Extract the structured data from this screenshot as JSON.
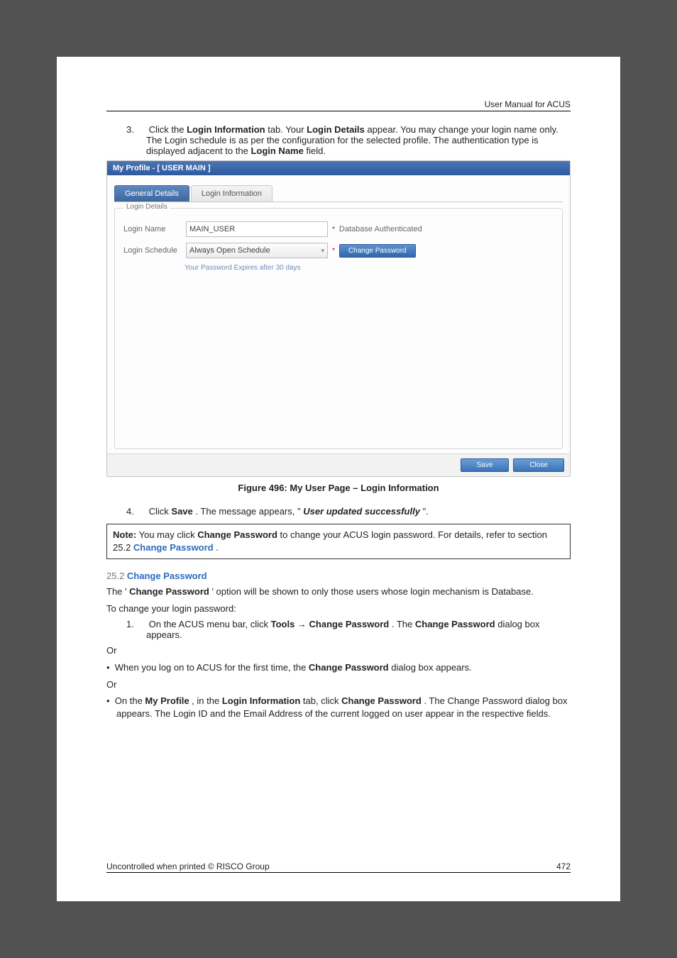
{
  "header": {
    "manual": "User Manual for ACUS"
  },
  "step3": {
    "num": "3.",
    "text_parts": {
      "a": "Click the ",
      "b": "Login Information",
      "c": " tab. Your ",
      "d": "Login Details",
      "e": " appear. You may change your login name only. The Login schedule is as per the configuration for the selected profile. The authentication type is displayed adjacent to the ",
      "f": "Login Name",
      "g": " field."
    }
  },
  "screenshot": {
    "titlebar": "My Profile - [ USER MAIN ]",
    "tabs": {
      "general": "General Details",
      "login": "Login Information"
    },
    "legend": "Login Details",
    "fields": {
      "login_name_label": "Login Name",
      "login_name_value": "MAIN_USER",
      "auth_text": "Database Authenticated",
      "schedule_label": "Login Schedule",
      "schedule_value": "Always Open Schedule",
      "change_pw_btn": "Change Password",
      "hint": "Your Password Expires after 30 days"
    },
    "footer": {
      "save": "Save",
      "close": "Close"
    }
  },
  "figure_caption": "Figure 496: My User Page – Login Information",
  "step4": {
    "num": "4.",
    "a": "Click ",
    "b": "Save",
    "c": ". The message appears, \"",
    "d": "User updated successfully",
    "e": "\"."
  },
  "note": {
    "a": "Note:",
    "b": " You may click ",
    "c": "Change Password",
    "d": " to change your ACUS login password. For details, refer to section 25.2 ",
    "e": "Change Password",
    "f": "."
  },
  "section": {
    "num": "25.2 ",
    "title": "Change Password"
  },
  "para1": {
    "a": "The '",
    "b": "Change Password",
    "c": "' option will be shown to only those users whose login mechanism is Database."
  },
  "para2": "To change your login password:",
  "sub1": {
    "num": "1.",
    "a": "On the ACUS menu bar, click ",
    "b": "Tools",
    "arrow": " → ",
    "c": "Change Password",
    "d": ". The ",
    "e": "Change Password",
    "f": " dialog box appears."
  },
  "or": "Or",
  "bullet1": {
    "a": "When you log on to ACUS for the first time, the ",
    "b": "Change Password",
    "c": " dialog box appears."
  },
  "bullet2": {
    "a": "On the ",
    "b": "My Profile",
    "c": ", in the ",
    "d": "Login Information",
    "e": " tab, click ",
    "f": "Change Password",
    "g": ". The Change Password dialog box appears. The Login ID and the Email Address of the current logged on user appear in the respective fields."
  },
  "footer": {
    "left": "Uncontrolled when printed © RISCO Group",
    "right": "472"
  }
}
